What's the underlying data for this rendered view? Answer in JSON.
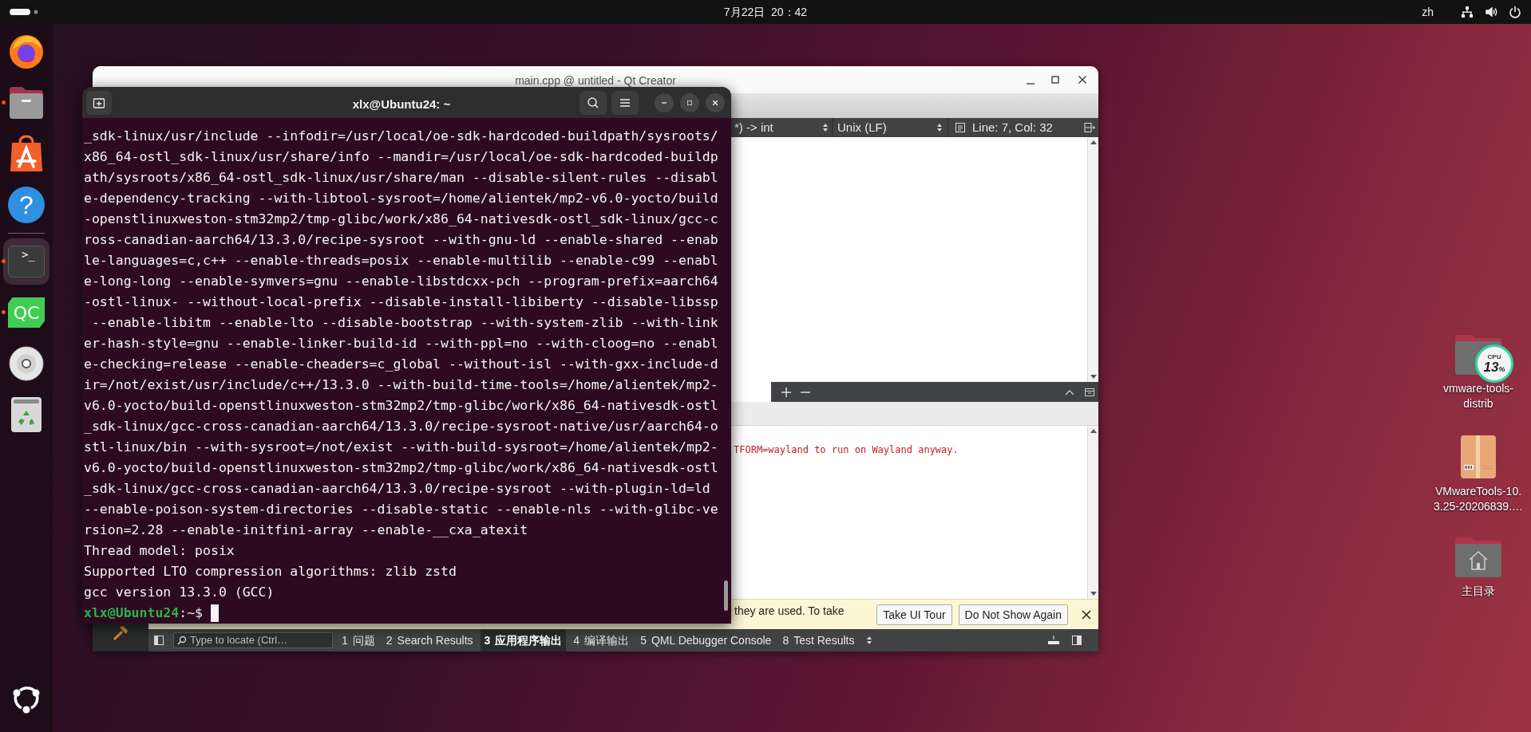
{
  "top_bar": {
    "clock": "7月22日  20：42",
    "input_method": "zh"
  },
  "dock": {
    "items": [
      {
        "kind": "firefox",
        "running": false,
        "selected": false
      },
      {
        "kind": "files",
        "running": true,
        "selected": false
      },
      {
        "kind": "app-center",
        "running": false,
        "selected": false
      },
      {
        "kind": "help",
        "glyph": "?",
        "running": false,
        "selected": false
      },
      {
        "kind": "terminal",
        "glyph": ">_",
        "running": true,
        "selected": true
      },
      {
        "kind": "qt-creator",
        "glyph": "QC",
        "running": true,
        "selected": false
      },
      {
        "kind": "disc",
        "running": false,
        "selected": false
      },
      {
        "kind": "trash",
        "running": false,
        "selected": false
      }
    ]
  },
  "desktop_icons": [
    {
      "kind": "folder",
      "lines": [
        "vmware-tools-",
        "distrib"
      ]
    },
    {
      "kind": "package",
      "lines": [
        "VMwareTools-10.",
        "3.25-20206839.…"
      ]
    },
    {
      "kind": "home-folder",
      "lines": [
        "主目录"
      ]
    }
  ],
  "cpu_widget": {
    "label": "CPU",
    "value": "13",
    "unit": "%"
  },
  "qt_window": {
    "title": "main.cpp @ untitled - Qt Creator",
    "editor_toolbar": {
      "function_combo": "*) -> int",
      "line_ending_combo": "Unix (LF)",
      "cursor_position": "Line: 7, Col: 32"
    },
    "output_text": "TFORM=wayland to run on Wayland anyway.",
    "info_bar": {
      "message": "they are used. To take",
      "buttons": [
        "Take UI Tour",
        "Do Not Show Again"
      ]
    },
    "status_bar": {
      "locator_placeholder": "Type to locate (Ctrl…",
      "panes": [
        {
          "number": "1",
          "label": "问题",
          "selected": false
        },
        {
          "number": "2",
          "label": "Search Results",
          "selected": false
        },
        {
          "number": "3",
          "label": "应用程序输出",
          "selected": true
        },
        {
          "number": "4",
          "label": "编译输出",
          "selected": false
        },
        {
          "number": "5",
          "label": "QML Debugger Console",
          "selected": false
        },
        {
          "number": "8",
          "label": "Test Results",
          "selected": false
        }
      ]
    }
  },
  "terminal": {
    "title": "xlx@Ubuntu24: ~",
    "lines": [
      "_sdk-linux/usr/include --infodir=/usr/local/oe-sdk-hardcoded-buildpath/sysroots/",
      "x86_64-ostl_sdk-linux/usr/share/info --mandir=/usr/local/oe-sdk-hardcoded-buildp",
      "ath/sysroots/x86_64-ostl_sdk-linux/usr/share/man --disable-silent-rules --disabl",
      "e-dependency-tracking --with-libtool-sysroot=/home/alientek/mp2-v6.0-yocto/build",
      "-openstlinuxweston-stm32mp2/tmp-glibc/work/x86_64-nativesdk-ostl_sdk-linux/gcc-c",
      "ross-canadian-aarch64/13.3.0/recipe-sysroot --with-gnu-ld --enable-shared --enab",
      "le-languages=c,c++ --enable-threads=posix --enable-multilib --enable-c99 --enabl",
      "e-long-long --enable-symvers=gnu --enable-libstdcxx-pch --program-prefix=aarch64",
      "-ostl-linux- --without-local-prefix --disable-install-libiberty --disable-libssp",
      " --enable-libitm --enable-lto --disable-bootstrap --with-system-zlib --with-link",
      "er-hash-style=gnu --enable-linker-build-id --with-ppl=no --with-cloog=no --enabl",
      "e-checking=release --enable-cheaders=c_global --without-isl --with-gxx-include-d",
      "ir=/not/exist/usr/include/c++/13.3.0 --with-build-time-tools=/home/alientek/mp2-",
      "v6.0-yocto/build-openstlinuxweston-stm32mp2/tmp-glibc/work/x86_64-nativesdk-ostl",
      "_sdk-linux/gcc-cross-canadian-aarch64/13.3.0/recipe-sysroot-native/usr/aarch64-o",
      "stl-linux/bin --with-sysroot=/not/exist --with-build-sysroot=/home/alientek/mp2-",
      "v6.0-yocto/build-openstlinuxweston-stm32mp2/tmp-glibc/work/x86_64-nativesdk-ostl",
      "_sdk-linux/gcc-cross-canadian-aarch64/13.3.0/recipe-sysroot --with-plugin-ld=ld",
      "--enable-poison-system-directories --disable-static --enable-nls --with-glibc-ve",
      "rsion=2.28 --enable-initfini-array --enable-__cxa_atexit",
      "Thread model: posix",
      "Supported LTO compression algorithms: zlib zstd",
      "gcc version 13.3.0 (GCC)"
    ],
    "prompt": {
      "user_host": "xlx@Ubuntu24",
      "path": ":~$"
    }
  }
}
